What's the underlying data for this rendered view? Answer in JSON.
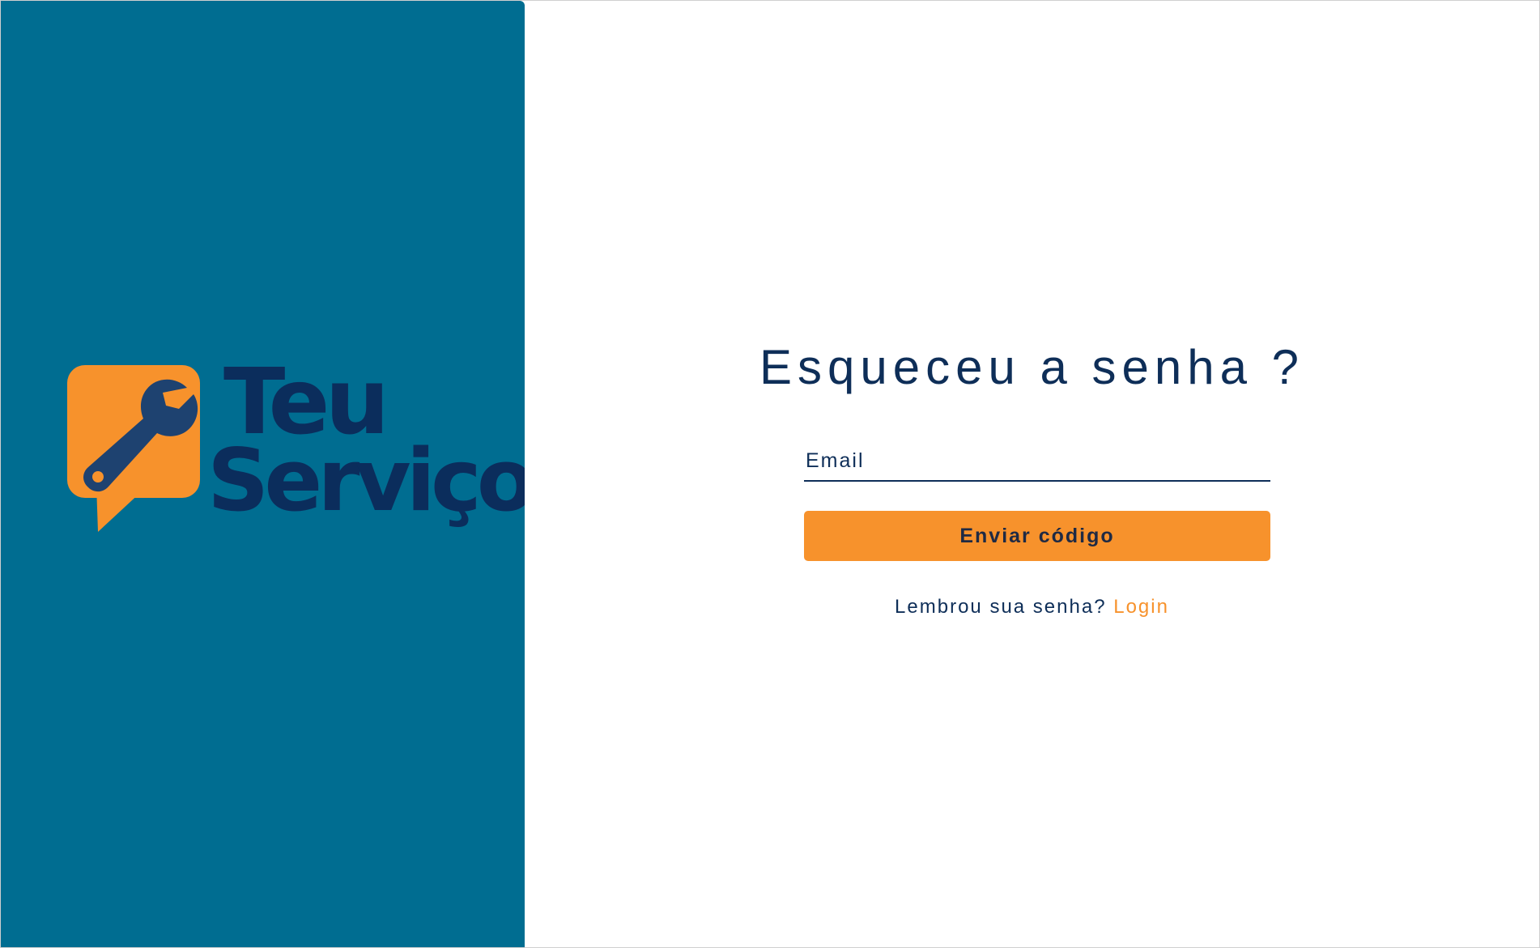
{
  "brand": {
    "line1": "Teu",
    "line2": "Serviço",
    "icon": "wrench-chat-bubble-icon",
    "colors": {
      "panel": "#006d91",
      "logo_orange": "#f7922c",
      "logo_navy": "#0b2d5c"
    }
  },
  "form": {
    "title": "Esqueceu a senha ?",
    "email_placeholder": "Email",
    "email_value": "",
    "submit_label": "Enviar código",
    "footer_text": "Lembrou sua senha?",
    "login_link": "Login"
  },
  "colors": {
    "accent": "#f7922c",
    "text": "#0e2e58",
    "background": "#ffffff"
  }
}
